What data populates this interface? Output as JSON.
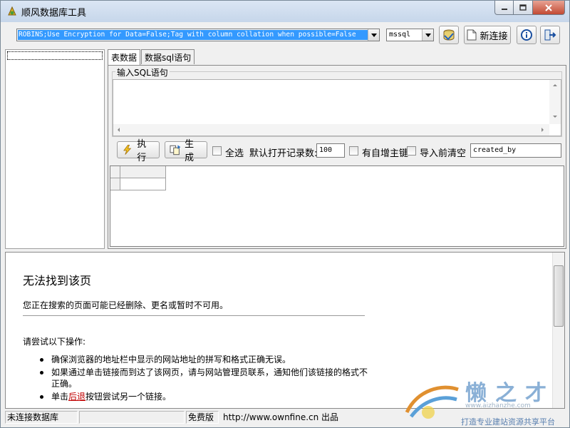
{
  "window": {
    "title": "顺风数据库工具"
  },
  "toolbar": {
    "connection_string": "ROBINS;Use Encryption for Data=False;Tag with column collation when possible=False",
    "db_type": "mssql",
    "new_connection_label": "新连接",
    "icons": [
      "database-icon",
      "new-doc-icon",
      "info-icon",
      "exit-icon"
    ]
  },
  "tabs": [
    {
      "label": "表数据",
      "active": true
    },
    {
      "label": "数据sql语句",
      "active": false
    }
  ],
  "sql": {
    "group_label": "输入SQL语句",
    "text": ""
  },
  "actions": {
    "execute_label": "执行",
    "generate_label": "生成",
    "select_all_label": "全选",
    "open_records_label": "默认打开记录数:",
    "open_records_value": "100",
    "auto_pk_label": "有自增主键",
    "clear_before_import_label": "导入前清空",
    "field_value": "created_by"
  },
  "browser": {
    "title": "无法找到该页",
    "description": "您正在搜索的页面可能已经删除、更名或暂时不可用。",
    "try_text": "请尝试以下操作:",
    "tips": [
      {
        "text": "确保浏览器的地址栏中显示的网站地址的拼写和格式正确无误。"
      },
      {
        "text": "如果通过单击链接而到达了该网页，请与网站管理员联系，通知他们该链接的格式不正确。"
      },
      {
        "before": "单击",
        "link": "后退",
        "after": "按钮尝试另一个链接。"
      }
    ]
  },
  "watermark": {
    "brand": "懒之才",
    "url": "www.aizhanzhe.com",
    "slogan": "打造专业建站资源共享平台"
  },
  "statusbar": {
    "connection_status": "未连接数据库",
    "blank": "",
    "edition": "免费版",
    "credit": "http://www.ownfine.cn 出品"
  },
  "colors": {
    "selection": "#3399ff",
    "link": "#c00000",
    "close_button": "#c24a33"
  }
}
